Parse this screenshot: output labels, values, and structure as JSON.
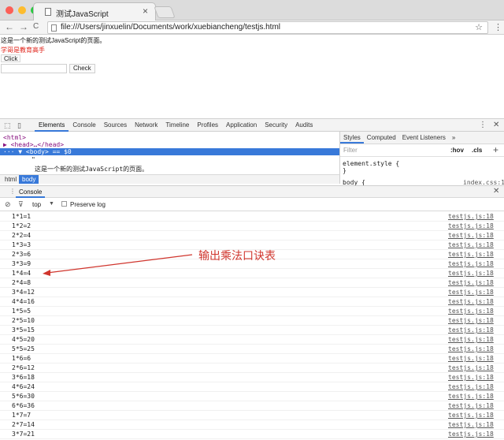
{
  "browser": {
    "tab_title": "测试JavaScript",
    "tab_close": "×",
    "url": "file:///Users/jinxuelin/Documents/work/xuebiancheng/testjs.html",
    "back_glyph": "←",
    "forward_glyph": "→",
    "reload_glyph": "C",
    "star_glyph": "☆",
    "menu_glyph": "⋮",
    "traffic_lights": [
      "#fc5f57",
      "#fdbc2e",
      "#29c940"
    ]
  },
  "page": {
    "paragraph": "这是一个新的测试JavaScript的页面。",
    "red_text": "学哥是教育高手",
    "red_color": "#e0241b",
    "click_button": "Click",
    "input_value": "",
    "check_button": "Check"
  },
  "devtools": {
    "tabs": [
      "Elements",
      "Console",
      "Sources",
      "Network",
      "Timeline",
      "Profiles",
      "Application",
      "Security",
      "Audits"
    ],
    "active_tab": "Elements",
    "menu_glyph": "⋮",
    "close_glyph": "✕",
    "elements": {
      "line_html": "<html>",
      "line_head": "▶ <head>…</head>",
      "line_body": "··· ▼ <body> == $0",
      "line_quote": "\"",
      "line_text": "这是一个新的测试JavaScript的页面。",
      "breadcrumbs": [
        "html",
        "body"
      ]
    },
    "styles": {
      "tabs": [
        "Styles",
        "Computed",
        "Event Listeners",
        "»"
      ],
      "filter_placeholder": "Filter",
      "hov": ":hov",
      "cls": ".cls",
      "plus": "+",
      "rule1": "element.style {",
      "rule1_close": "}",
      "rule2": "body {",
      "rule2_source": "index.css:1"
    },
    "console_drawer": {
      "tab": "Console",
      "context": "top",
      "preserve_log": "Preserve log",
      "close_glyph": "✕"
    },
    "console_logs": [
      {
        "msg": "1*1=1",
        "src": "testjs.js:18"
      },
      {
        "msg": "1*2=2",
        "src": "testjs.js:18"
      },
      {
        "msg": "2*2=4",
        "src": "testjs.js:18"
      },
      {
        "msg": "1*3=3",
        "src": "testjs.js:18"
      },
      {
        "msg": "2*3=6",
        "src": "testjs.js:18"
      },
      {
        "msg": "3*3=9",
        "src": "testjs.js:18"
      },
      {
        "msg": "1*4=4",
        "src": "testjs.js:18"
      },
      {
        "msg": "2*4=8",
        "src": "testjs.js:18"
      },
      {
        "msg": "3*4=12",
        "src": "testjs.js:18"
      },
      {
        "msg": "4*4=16",
        "src": "testjs.js:18"
      },
      {
        "msg": "1*5=5",
        "src": "testjs.js:18"
      },
      {
        "msg": "2*5=10",
        "src": "testjs.js:18"
      },
      {
        "msg": "3*5=15",
        "src": "testjs.js:18"
      },
      {
        "msg": "4*5=20",
        "src": "testjs.js:18"
      },
      {
        "msg": "5*5=25",
        "src": "testjs.js:18"
      },
      {
        "msg": "1*6=6",
        "src": "testjs.js:18"
      },
      {
        "msg": "2*6=12",
        "src": "testjs.js:18"
      },
      {
        "msg": "3*6=18",
        "src": "testjs.js:18"
      },
      {
        "msg": "4*6=24",
        "src": "testjs.js:18"
      },
      {
        "msg": "5*6=30",
        "src": "testjs.js:18"
      },
      {
        "msg": "6*6=36",
        "src": "testjs.js:18"
      },
      {
        "msg": "1*7=7",
        "src": "testjs.js:18"
      },
      {
        "msg": "2*7=14",
        "src": "testjs.js:18"
      },
      {
        "msg": "3*7=21",
        "src": "testjs.js:18"
      }
    ]
  },
  "annotation": {
    "text": "输出乘法口诀表",
    "color": "#d0352d"
  }
}
